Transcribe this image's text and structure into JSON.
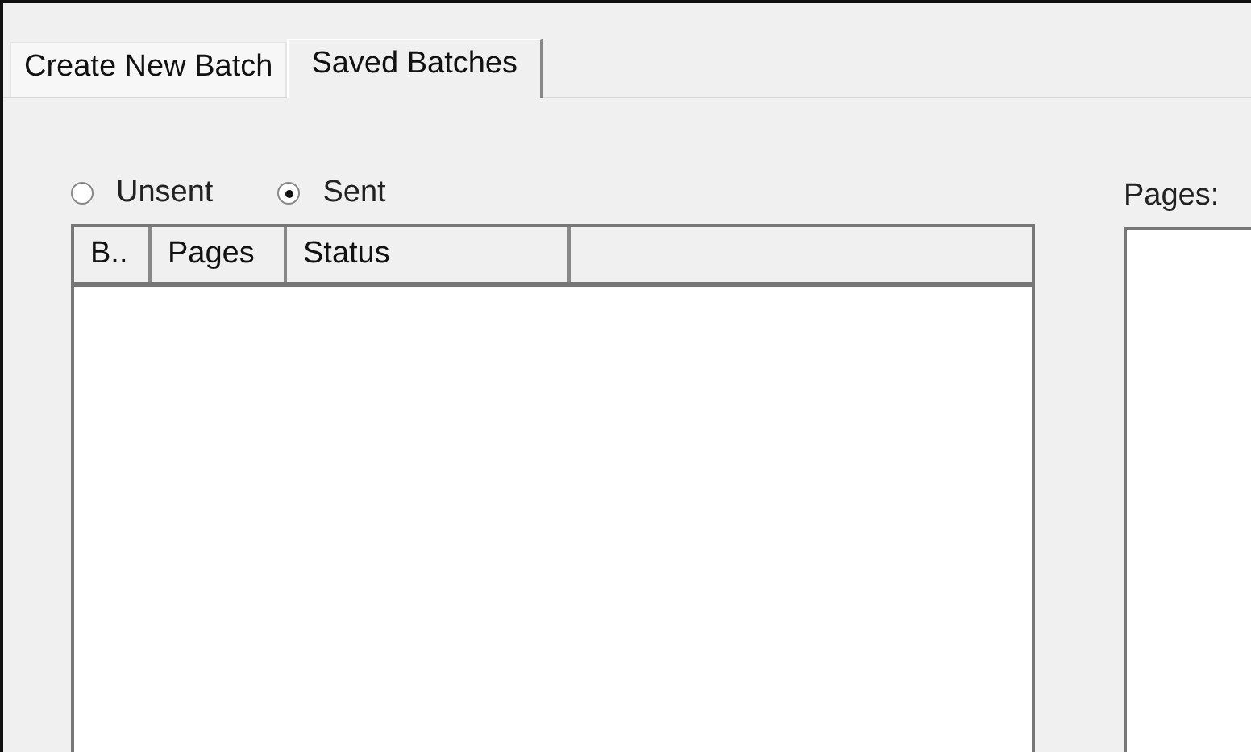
{
  "tabs": [
    {
      "label": "Create New Batch",
      "selected": false
    },
    {
      "label": "Saved Batches",
      "selected": true
    }
  ],
  "filter": [
    {
      "label": "Unsent",
      "selected": false
    },
    {
      "label": "Sent",
      "selected": true
    }
  ],
  "batch_list": {
    "columns": [
      "B..",
      "Pages",
      "Status"
    ]
  },
  "pages_list": {
    "label": "Pages:"
  }
}
